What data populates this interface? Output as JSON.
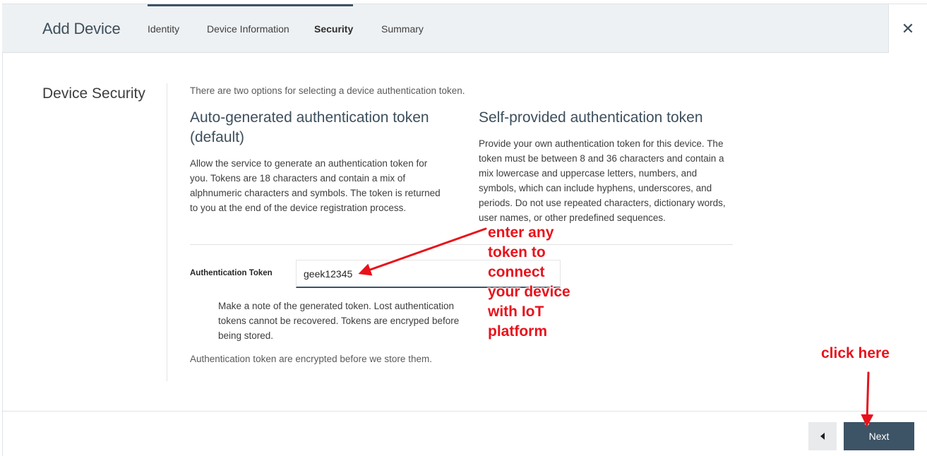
{
  "header": {
    "title": "Add Device",
    "tabs": [
      "Identity",
      "Device Information",
      "Security",
      "Summary"
    ],
    "close_glyph": "✕"
  },
  "section": {
    "title": "Device Security",
    "intro": "There are two options for selecting a device authentication token."
  },
  "auto_option": {
    "heading_line1": "Auto-generated authentication token",
    "heading_line2": "(default)",
    "text_lines": [
      "Allow the service to generate an authentication token for",
      "you. Tokens are 18 characters and contain a mix of",
      "alphnumeric characters and symbols. The token is returned",
      "to you at the end of the device registration process."
    ]
  },
  "self_option": {
    "heading": "Self-provided authentication token",
    "text_lines": [
      "Provide your own authentication token for this device. The",
      "token must be between 8 and 36 characters and contain a",
      "mix lowercase and uppercase letters, numbers, and",
      "symbols, which can include hyphens, underscores, and",
      "periods. Do not use repeated characters, dictionary words,",
      "user names, or other predefined sequences."
    ]
  },
  "token_field": {
    "label": "Authentication Token",
    "value": "geek12345"
  },
  "note_lines": [
    "Make a note of the generated token. Lost authentication",
    "tokens cannot be recovered. Tokens are encryped before",
    "being stored."
  ],
  "footnote": "Authentication token are encrypted before we store them.",
  "footer": {
    "back_icon": "chevron-left-icon",
    "next_label": "Next"
  },
  "annotations": {
    "token_hint_lines": [
      "enter any",
      "token to",
      "connect",
      "your device",
      "with IoT",
      "platform"
    ],
    "click_hint": "click here",
    "color": "#e8121b"
  },
  "colors": {
    "header_bg": "#eef1f3",
    "accent": "#3d5366"
  }
}
